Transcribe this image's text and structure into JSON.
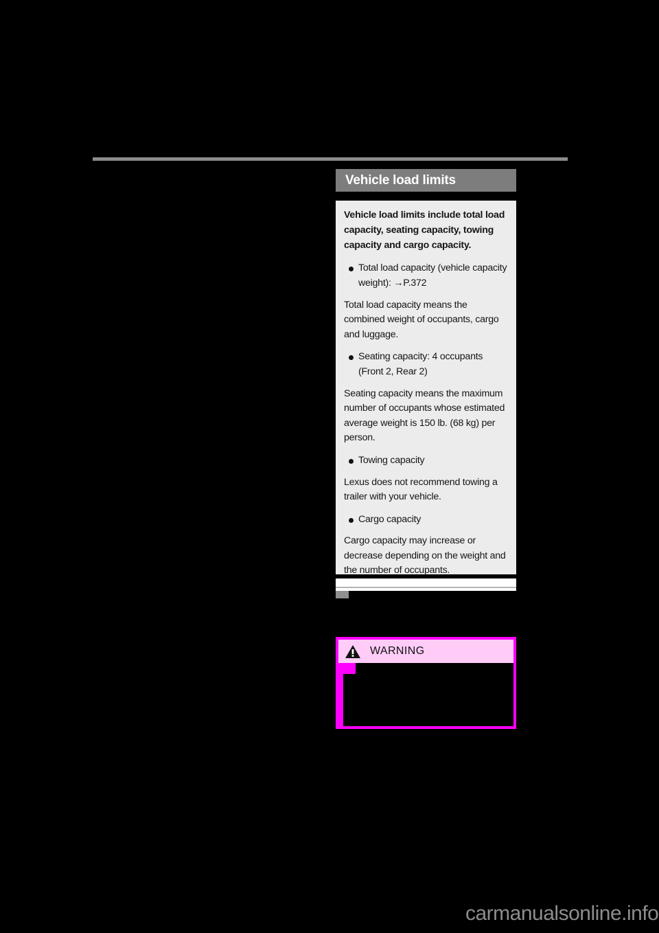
{
  "page": {
    "background_color": "#000000",
    "watermark": "carmanualsonline.info"
  },
  "section": {
    "header_title": "Vehicle load limits",
    "header_bg_color": "#7d7d7d",
    "panel_bg_color": "#ececec"
  },
  "info_panel": {
    "lead": "Vehicle load limits include total load capacity, seating capacity, towing capacity and cargo capacity.",
    "blocks": [
      {
        "type": "bullet",
        "text": "Total load capacity (vehicle capacity weight): →P.372"
      },
      {
        "type": "paragraph",
        "text": "Total load capacity means the combined weight of occupants, cargo and luggage."
      },
      {
        "type": "bullet",
        "text": "Seating capacity: 4 occupants (Front 2, Rear 2)"
      },
      {
        "type": "paragraph",
        "text": "Seating capacity means the maximum number of occupants whose estimated average weight is 150 lb. (68 kg) per person."
      },
      {
        "type": "bullet",
        "text": "Towing capacity"
      },
      {
        "type": "paragraph",
        "text": "Lexus does not recommend towing a trailer with your vehicle."
      },
      {
        "type": "bullet",
        "text": "Cargo capacity"
      },
      {
        "type": "paragraph",
        "text": "Cargo capacity may increase or decrease depending on the weight and the number of occupants."
      }
    ]
  },
  "subsection": {
    "heading": ""
  },
  "warning": {
    "label": "WARNING",
    "icon": "warning-triangle-icon",
    "border_color": "#ff00ff",
    "header_bg_color": "#ffccf7",
    "body_text": ""
  }
}
